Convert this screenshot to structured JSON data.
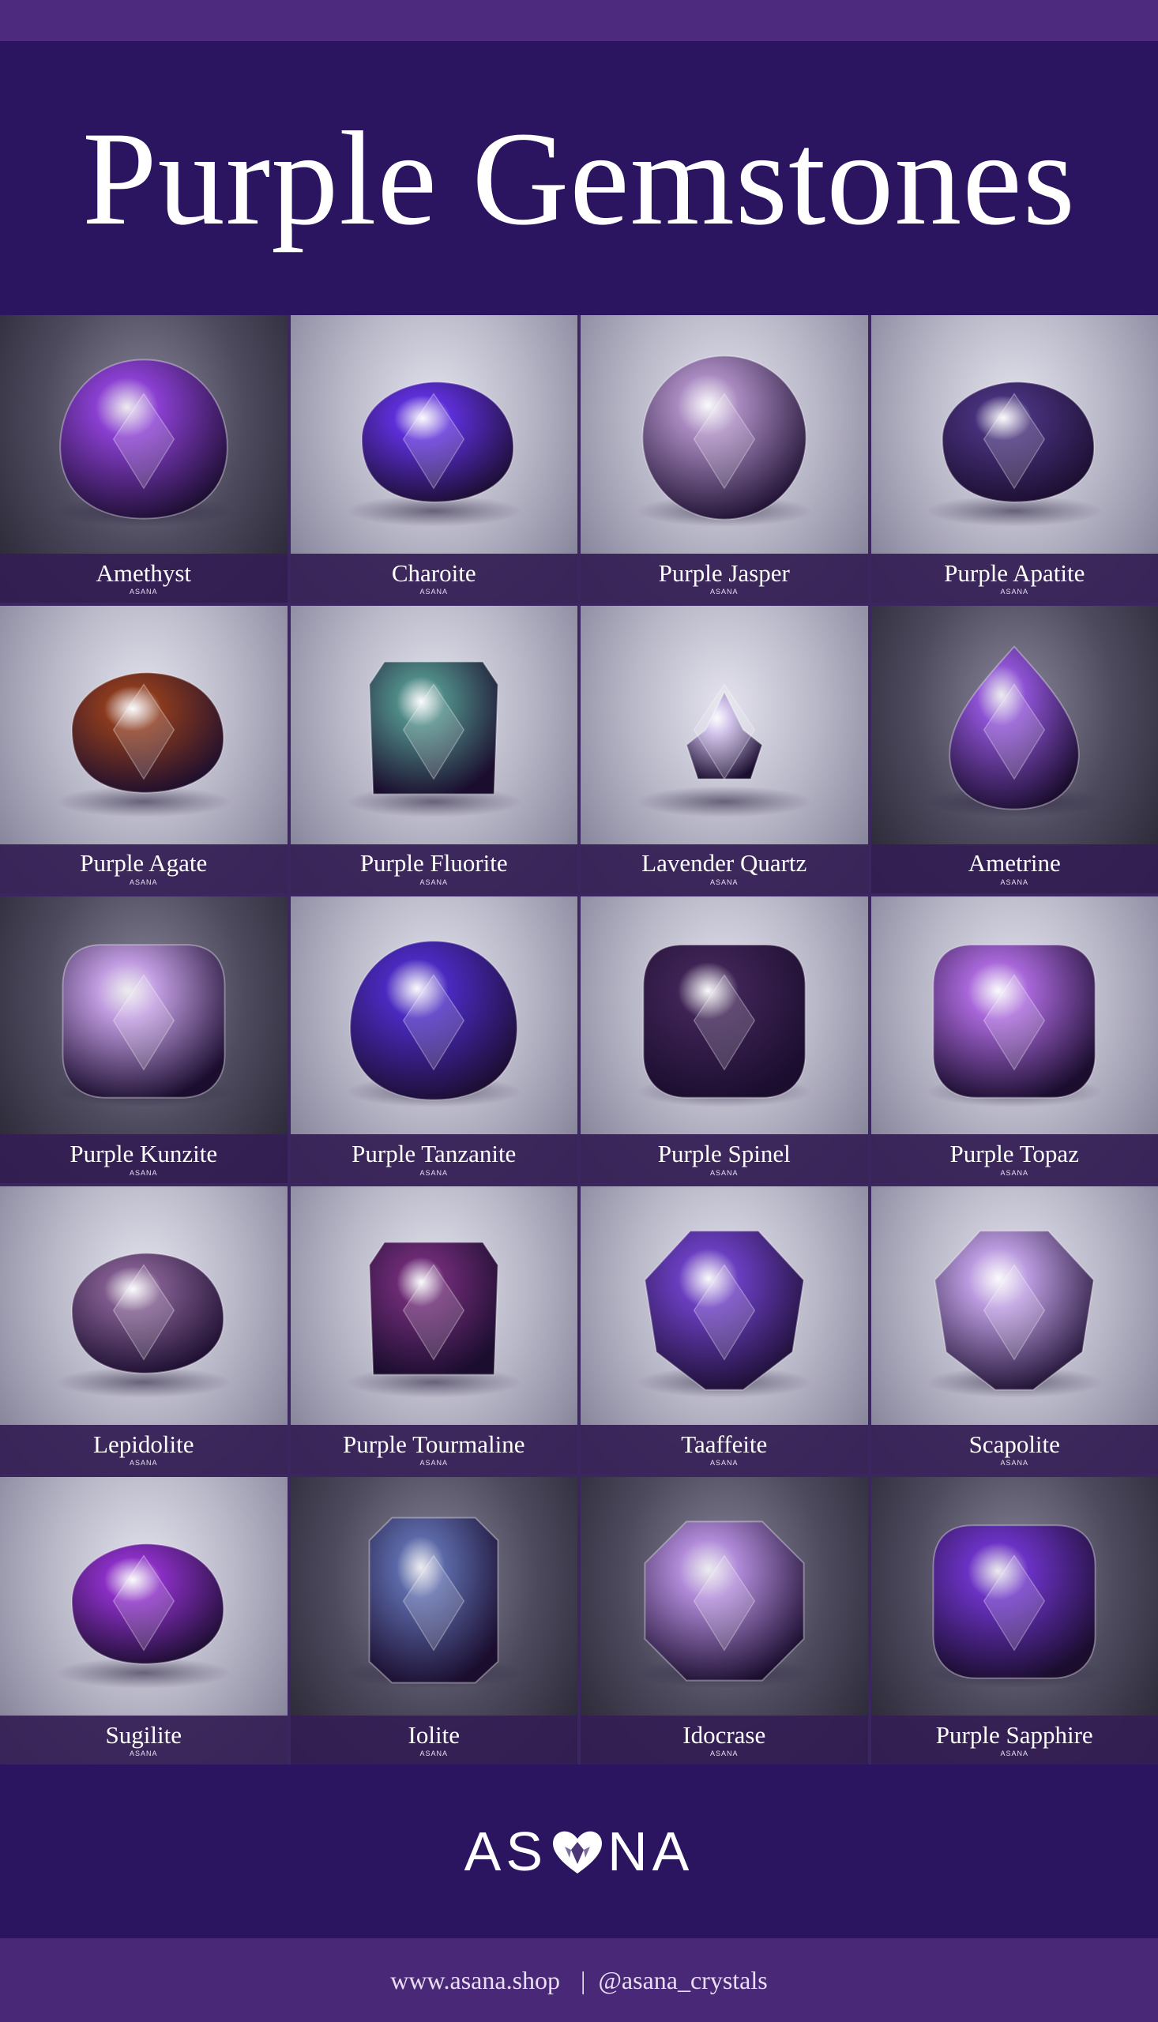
{
  "title": "Purple Gemstones",
  "gems": [
    {
      "name": "Amethyst",
      "color": "#8a3fd1",
      "shape": "oval",
      "dark": true
    },
    {
      "name": "Charoite",
      "color": "#5d2fd8",
      "shape": "pebble",
      "dark": false
    },
    {
      "name": "Purple Jasper",
      "color": "#a98ac0",
      "shape": "round",
      "dark": false
    },
    {
      "name": "Purple Apatite",
      "color": "#46307a",
      "shape": "pebble",
      "dark": false
    },
    {
      "name": "Purple Agate",
      "color": "#8a3a1e",
      "shape": "pebble",
      "dark": false
    },
    {
      "name": "Purple Fluorite",
      "color": "#4f8a86",
      "shape": "prism",
      "dark": false
    },
    {
      "name": "Lavender Quartz",
      "color": "#c7b6e6",
      "shape": "cluster",
      "dark": false
    },
    {
      "name": "Ametrine",
      "color": "#8d52d3",
      "shape": "drop",
      "dark": true
    },
    {
      "name": "Purple Kunzite",
      "color": "#c09be0",
      "shape": "cushion",
      "dark": true
    },
    {
      "name": "Purple Tanzanite",
      "color": "#4a2ac0",
      "shape": "oval",
      "dark": false
    },
    {
      "name": "Purple Spinel",
      "color": "#3e2354",
      "shape": "cushion",
      "dark": false
    },
    {
      "name": "Purple Topaz",
      "color": "#a867d9",
      "shape": "cushion",
      "dark": false
    },
    {
      "name": "Lepidolite",
      "color": "#7e5a8c",
      "shape": "pebble",
      "dark": false
    },
    {
      "name": "Purple Tourmaline",
      "color": "#6b2a73",
      "shape": "prism",
      "dark": false
    },
    {
      "name": "Taaffeite",
      "color": "#6a3ec0",
      "shape": "faceted",
      "dark": false
    },
    {
      "name": "Scapolite",
      "color": "#bb9bdf",
      "shape": "faceted",
      "dark": false
    },
    {
      "name": "Sugilite",
      "color": "#8a2fc4",
      "shape": "pebble",
      "dark": false
    },
    {
      "name": "Iolite",
      "color": "#5b69a8",
      "shape": "emerald",
      "dark": true
    },
    {
      "name": "Idocrase",
      "color": "#b08ad8",
      "shape": "octagon",
      "dark": true
    },
    {
      "name": "Purple Sapphire",
      "color": "#6b32c4",
      "shape": "cushion",
      "dark": true
    }
  ],
  "tile_mark": "ASANA",
  "logo": {
    "left": "AS",
    "right": "NA",
    "icon": "heart-crystal-icon"
  },
  "footer": {
    "website": "www.asana.shop",
    "separator": "|",
    "handle": "@asana_crystals"
  }
}
